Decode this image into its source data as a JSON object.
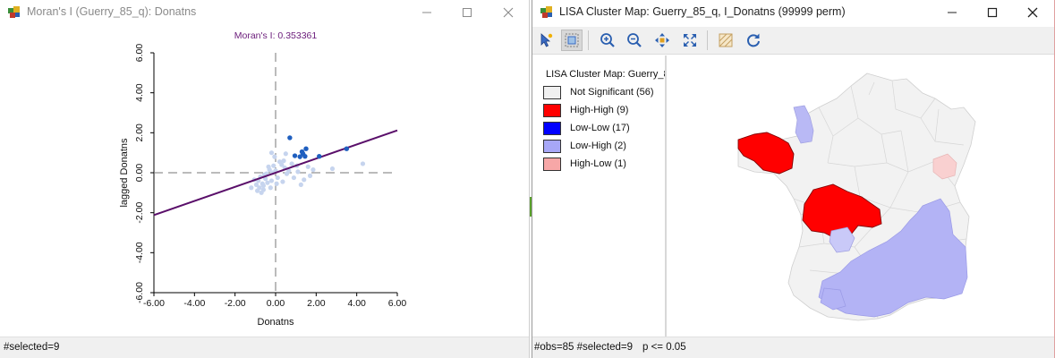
{
  "left_window": {
    "title": "Moran's I (Guerry_85_q): Donatns",
    "status": "#selected=9"
  },
  "right_window": {
    "title": "LISA Cluster Map: Guerry_85_q, I_Donatns (99999 perm)",
    "legend_title": "LISA Cluster Map: Guerry_8",
    "legend": [
      {
        "label": "Not Significant (56)",
        "color": "#f0f0f0"
      },
      {
        "label": "High-High (9)",
        "color": "#ff0000"
      },
      {
        "label": "Low-Low (17)",
        "color": "#0000ff"
      },
      {
        "label": "Low-High (2)",
        "color": "#a7a7f7"
      },
      {
        "label": "High-Low (1)",
        "color": "#f7a7a7"
      }
    ],
    "status_obs": "#obs=85 #selected=9",
    "status_p": "p <= 0.05",
    "toolbar": [
      "select-icon",
      "select-mode-icon",
      "zoom-in-icon",
      "zoom-out-icon",
      "pan-icon",
      "fit-extent-icon",
      "layer-icon",
      "refresh-icon"
    ]
  },
  "chart_data": {
    "type": "scatter",
    "title": "Moran's I: 0.353361",
    "xlabel": "Donatns",
    "ylabel": "lagged Donatns",
    "xlim": [
      -6.0,
      6.0
    ],
    "ylim": [
      -6.0,
      6.0
    ],
    "xticks": [
      "-6.00",
      "-4.00",
      "-2.00",
      "0.00",
      "2.00",
      "4.00",
      "6.00"
    ],
    "yticks": [
      "-6.00",
      "-4.00",
      "-2.00",
      "0.00",
      "2.00",
      "4.00",
      "6.00"
    ],
    "regression": {
      "slope": 0.353361,
      "intercept": 0.0,
      "color": "#5a0f6a"
    },
    "colors": {
      "selected": "#1f5fbf",
      "unselected": "#c6d4ee"
    },
    "selected_points": [
      [
        0.7,
        1.75
      ],
      [
        0.95,
        0.85
      ],
      [
        1.2,
        0.8
      ],
      [
        1.35,
        0.95
      ],
      [
        1.3,
        1.05
      ],
      [
        1.5,
        1.2
      ],
      [
        1.45,
        0.82
      ],
      [
        2.15,
        0.82
      ],
      [
        3.5,
        1.2
      ]
    ],
    "unselected_points": [
      [
        -0.1,
        0.35
      ],
      [
        -0.05,
        0.8
      ],
      [
        -0.2,
        1.0
      ],
      [
        0.2,
        0.55
      ],
      [
        0.45,
        0.25
      ],
      [
        0.5,
        0.95
      ],
      [
        0.55,
        -0.05
      ],
      [
        0.1,
        -0.25
      ],
      [
        -0.3,
        0.15
      ],
      [
        -0.45,
        -0.05
      ],
      [
        -0.5,
        -0.3
      ],
      [
        -0.65,
        -0.55
      ],
      [
        -0.75,
        -0.2
      ],
      [
        -0.85,
        -0.4
      ],
      [
        -0.95,
        -0.6
      ],
      [
        -1.05,
        -0.35
      ],
      [
        -0.8,
        -0.75
      ],
      [
        -0.6,
        -0.85
      ],
      [
        -0.7,
        -1.0
      ],
      [
        -0.4,
        -0.5
      ],
      [
        -0.2,
        -0.4
      ],
      [
        -0.25,
        -0.75
      ],
      [
        -0.9,
        -0.9
      ],
      [
        0.3,
        0.4
      ],
      [
        0.4,
        0.6
      ],
      [
        0.65,
        0.1
      ],
      [
        0.8,
        0.45
      ],
      [
        1.05,
        0.35
      ],
      [
        1.6,
        0.3
      ],
      [
        1.85,
        0.15
      ],
      [
        1.7,
        -0.15
      ],
      [
        1.4,
        -0.35
      ],
      [
        1.25,
        -0.6
      ],
      [
        0.9,
        -0.25
      ],
      [
        4.3,
        0.45
      ],
      [
        2.8,
        0.2
      ],
      [
        0.0,
        0.1
      ],
      [
        -0.55,
        -0.1
      ],
      [
        -0.15,
        0.0
      ],
      [
        -1.2,
        -0.75
      ],
      [
        -0.35,
        0.3
      ],
      [
        0.05,
        -0.55
      ],
      [
        -0.6,
        -0.65
      ],
      [
        1.1,
        0.05
      ],
      [
        0.35,
        -0.45
      ]
    ]
  }
}
